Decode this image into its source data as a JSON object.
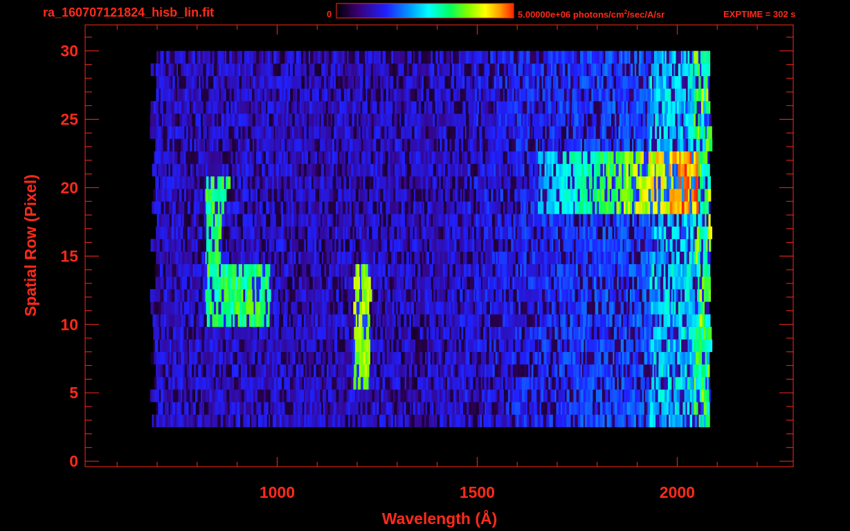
{
  "header": {
    "filename": "ra_160707121824_hisb_lin.fit",
    "colorbar_min": "0",
    "colorbar_max_value": "5.00000e+06",
    "colorbar_unit_prefix": "photons/cm",
    "colorbar_unit_sup": "2",
    "colorbar_unit_suffix": "/sec/A/sr",
    "exptime": "EXPTIME = 302 s"
  },
  "colors": {
    "axis": "#ff2a1a",
    "background": "#000000",
    "colormap": [
      "#000000",
      "#3a0070",
      "#2020ff",
      "#00a0ff",
      "#00ffff",
      "#00ff60",
      "#80ff00",
      "#ffff00",
      "#ffa000",
      "#ff2000"
    ]
  },
  "chart_data": {
    "type": "heatmap",
    "xlabel": "Wavelength (Å)",
    "ylabel": "Spatial Row (Pixel)",
    "xlim": [
      520,
      2290
    ],
    "ylim": [
      -0.4,
      31.9
    ],
    "xticks": [
      1000,
      1500,
      2000
    ],
    "yticks": [
      0,
      5,
      10,
      15,
      20,
      25,
      30
    ],
    "colorbar_range": [
      0,
      5000000
    ],
    "colorbar_unit": "photons/cm^2/sec/A/sr",
    "data_extent_x": [
      700,
      2080
    ],
    "data_extent_y": [
      2.5,
      30
    ],
    "features": [
      {
        "name": "bright emission band",
        "x_range": [
          1650,
          2050
        ],
        "y_range": [
          18,
          23
        ],
        "level": 0.62
      },
      {
        "name": "emission line",
        "x_range": [
          1190,
          1230
        ],
        "y_range": [
          5,
          14
        ],
        "level": 0.72
      },
      {
        "name": "curved bright arc",
        "x_range": [
          820,
          980
        ],
        "y_range": [
          10,
          21
        ],
        "level": 0.6
      }
    ]
  }
}
